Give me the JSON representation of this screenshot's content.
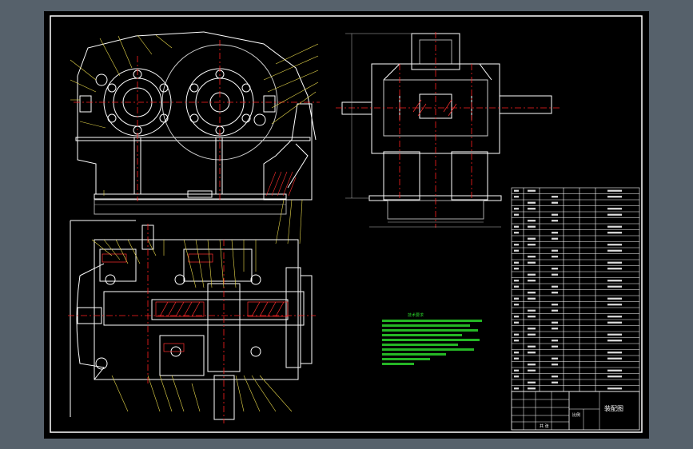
{
  "drawing": {
    "title_block": {
      "drawing_title": "装配图",
      "ratio_label": "比例",
      "sheet_label": "共  张"
    },
    "notes_title": "技术要求",
    "parts_table_rows": 20
  },
  "colors": {
    "viewport": "#56616b",
    "sheet": "#000000",
    "border": "#ffffff",
    "outline": "#ffffff",
    "centerline": "#ff2020",
    "callout": "#e8d84a",
    "notes": "#2bd62b",
    "hatch": "#ff3030"
  }
}
